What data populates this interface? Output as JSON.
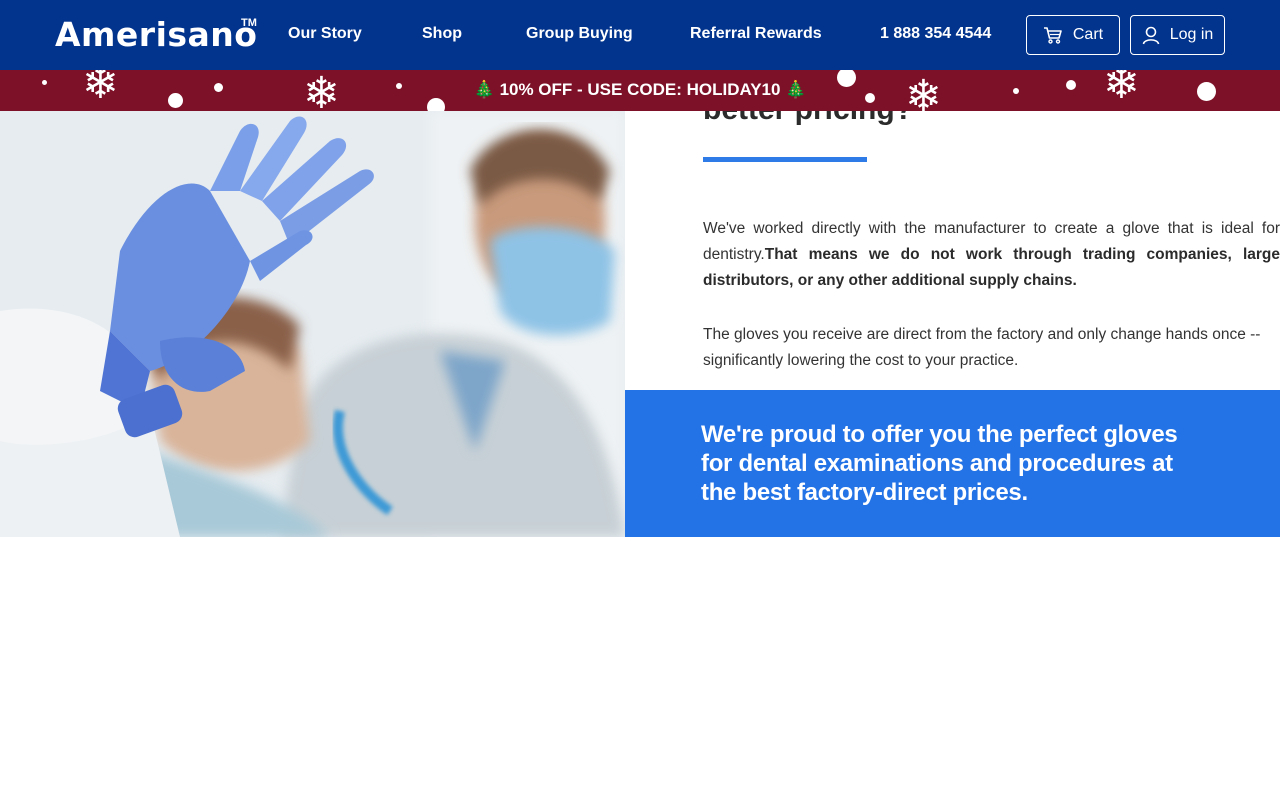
{
  "header": {
    "logo": "Amerisano",
    "logo_tm": "TM",
    "nav": [
      "Our Story",
      "Shop",
      "Group Buying",
      "Referral Rewards",
      "1 888 354 4544"
    ],
    "cart_label": "Cart",
    "login_label": "Log in"
  },
  "promo": {
    "text": "10% OFF - USE CODE: HOLIDAY10",
    "icon_left": "🎄",
    "icon_right": "🎄"
  },
  "main": {
    "heading": "better pricing?",
    "para1_plain": "We've worked directly with the manufacturer to create a glove that is ideal for dentistry.",
    "para1_bold": "That means we do not work through trading companies, large distributors, or any other additional supply chains.",
    "para2": "The gloves you receive are direct from the factory and only change hands once -- significantly lowering the cost to your practice.",
    "callout": "We're proud to offer you the perfect gloves for dental examinations and procedures at the best factory-direct prices."
  },
  "colors": {
    "header_bg": "#02338d",
    "promo_bg": "#7d1128",
    "accent_blue": "#2372e6",
    "underline": "#2e7be8"
  },
  "icons": {
    "cart": "cart-icon",
    "user": "user-icon",
    "snowflake": "snowflake-icon",
    "tree": "christmas-tree-icon"
  }
}
